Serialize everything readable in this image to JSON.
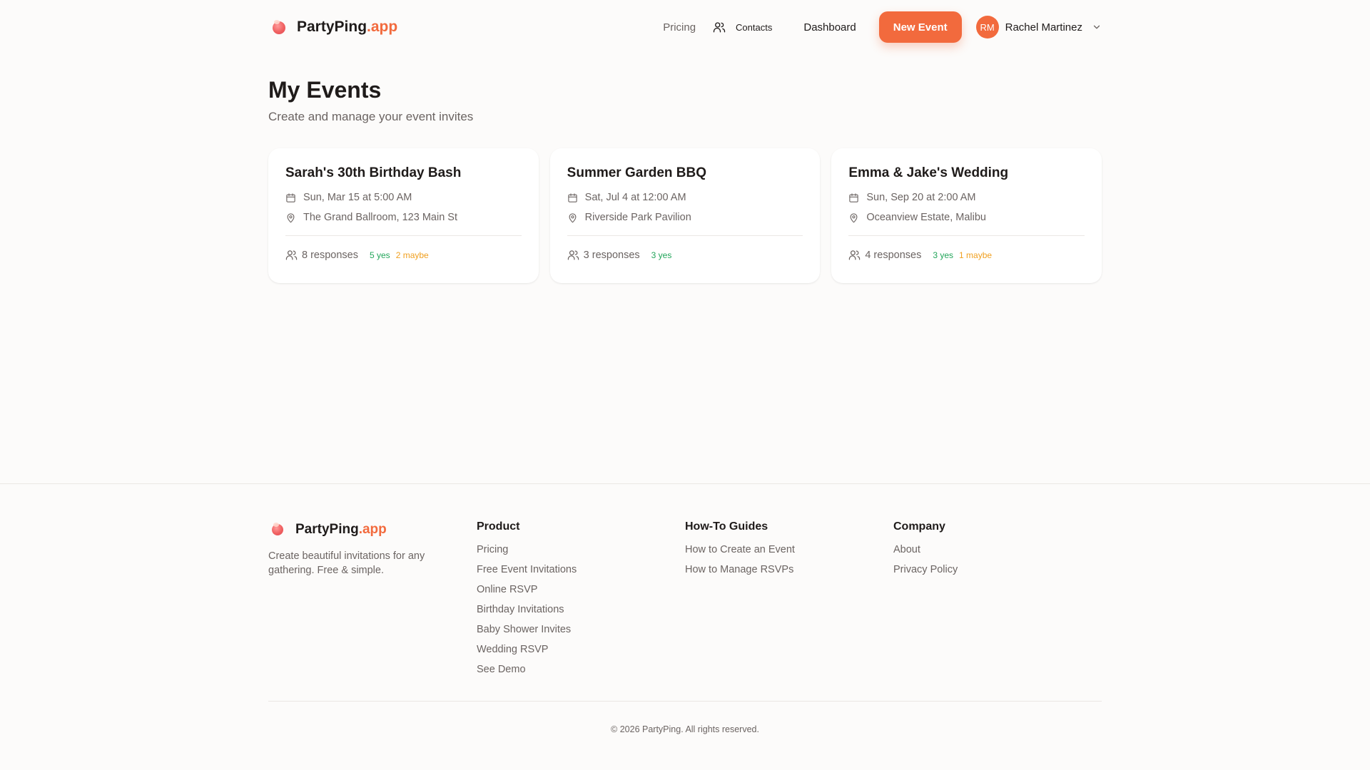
{
  "brand": {
    "name": "PartyPing",
    "suffix": ".app",
    "accent_color": "#f26a3d"
  },
  "nav": {
    "pricing": "Pricing",
    "contacts": "Contacts",
    "dashboard": "Dashboard",
    "new_event": "New Event",
    "user": {
      "initials": "RM",
      "name": "Rachel Martinez"
    }
  },
  "page": {
    "title": "My Events",
    "subtitle": "Create and manage your event invites"
  },
  "events": [
    {
      "title": "Sarah's 30th Birthday Bash",
      "date": "Sun, Mar 15 at 5:00 AM",
      "location": "The Grand Ballroom, 123 Main St",
      "responses": "8 responses",
      "yes": "5 yes",
      "maybe": "2 maybe"
    },
    {
      "title": "Summer Garden BBQ",
      "date": "Sat, Jul 4 at 12:00 AM",
      "location": "Riverside Park Pavilion",
      "responses": "3 responses",
      "yes": "3 yes",
      "maybe": ""
    },
    {
      "title": "Emma & Jake's Wedding",
      "date": "Sun, Sep 20 at 2:00 AM",
      "location": "Oceanview Estate, Malibu",
      "responses": "4 responses",
      "yes": "3 yes",
      "maybe": "1 maybe"
    }
  ],
  "footer": {
    "description": "Create beautiful invitations for any gathering. Free & simple.",
    "product": {
      "heading": "Product",
      "links": [
        "Pricing",
        "Free Event Invitations",
        "Online RSVP",
        "Birthday Invitations",
        "Baby Shower Invites",
        "Wedding RSVP",
        "See Demo"
      ]
    },
    "guides": {
      "heading": "How-To Guides",
      "links": [
        "How to Create an Event",
        "How to Manage RSVPs"
      ]
    },
    "company": {
      "heading": "Company",
      "links": [
        "About",
        "Privacy Policy"
      ]
    },
    "copyright": "© 2026 PartyPing. All rights reserved."
  },
  "colors": {
    "yes": "#22a55a",
    "maybe": "#f0a020",
    "accent": "#f26a3d"
  }
}
